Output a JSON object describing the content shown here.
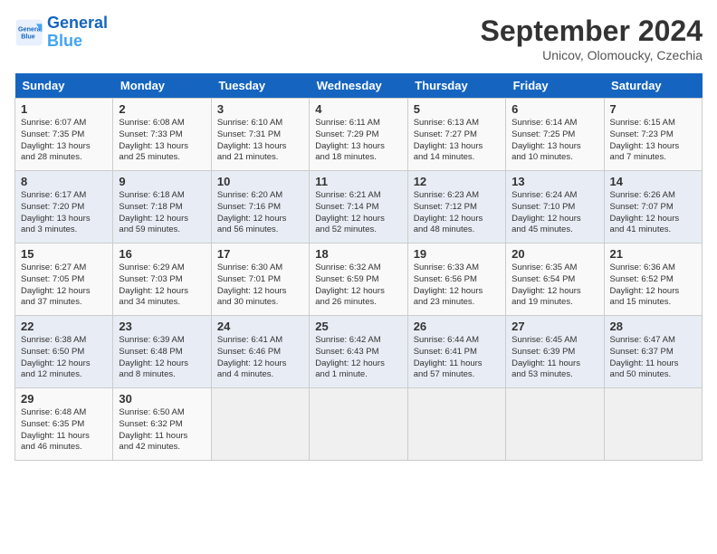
{
  "header": {
    "logo_line1": "General",
    "logo_line2": "Blue",
    "month": "September 2024",
    "location": "Unicov, Olomoucky, Czechia"
  },
  "weekdays": [
    "Sunday",
    "Monday",
    "Tuesday",
    "Wednesday",
    "Thursday",
    "Friday",
    "Saturday"
  ],
  "weeks": [
    [
      {
        "day": "1",
        "info": "Sunrise: 6:07 AM\nSunset: 7:35 PM\nDaylight: 13 hours\nand 28 minutes."
      },
      {
        "day": "2",
        "info": "Sunrise: 6:08 AM\nSunset: 7:33 PM\nDaylight: 13 hours\nand 25 minutes."
      },
      {
        "day": "3",
        "info": "Sunrise: 6:10 AM\nSunset: 7:31 PM\nDaylight: 13 hours\nand 21 minutes."
      },
      {
        "day": "4",
        "info": "Sunrise: 6:11 AM\nSunset: 7:29 PM\nDaylight: 13 hours\nand 18 minutes."
      },
      {
        "day": "5",
        "info": "Sunrise: 6:13 AM\nSunset: 7:27 PM\nDaylight: 13 hours\nand 14 minutes."
      },
      {
        "day": "6",
        "info": "Sunrise: 6:14 AM\nSunset: 7:25 PM\nDaylight: 13 hours\nand 10 minutes."
      },
      {
        "day": "7",
        "info": "Sunrise: 6:15 AM\nSunset: 7:23 PM\nDaylight: 13 hours\nand 7 minutes."
      }
    ],
    [
      {
        "day": "8",
        "info": "Sunrise: 6:17 AM\nSunset: 7:20 PM\nDaylight: 13 hours\nand 3 minutes."
      },
      {
        "day": "9",
        "info": "Sunrise: 6:18 AM\nSunset: 7:18 PM\nDaylight: 12 hours\nand 59 minutes."
      },
      {
        "day": "10",
        "info": "Sunrise: 6:20 AM\nSunset: 7:16 PM\nDaylight: 12 hours\nand 56 minutes."
      },
      {
        "day": "11",
        "info": "Sunrise: 6:21 AM\nSunset: 7:14 PM\nDaylight: 12 hours\nand 52 minutes."
      },
      {
        "day": "12",
        "info": "Sunrise: 6:23 AM\nSunset: 7:12 PM\nDaylight: 12 hours\nand 48 minutes."
      },
      {
        "day": "13",
        "info": "Sunrise: 6:24 AM\nSunset: 7:10 PM\nDaylight: 12 hours\nand 45 minutes."
      },
      {
        "day": "14",
        "info": "Sunrise: 6:26 AM\nSunset: 7:07 PM\nDaylight: 12 hours\nand 41 minutes."
      }
    ],
    [
      {
        "day": "15",
        "info": "Sunrise: 6:27 AM\nSunset: 7:05 PM\nDaylight: 12 hours\nand 37 minutes."
      },
      {
        "day": "16",
        "info": "Sunrise: 6:29 AM\nSunset: 7:03 PM\nDaylight: 12 hours\nand 34 minutes."
      },
      {
        "day": "17",
        "info": "Sunrise: 6:30 AM\nSunset: 7:01 PM\nDaylight: 12 hours\nand 30 minutes."
      },
      {
        "day": "18",
        "info": "Sunrise: 6:32 AM\nSunset: 6:59 PM\nDaylight: 12 hours\nand 26 minutes."
      },
      {
        "day": "19",
        "info": "Sunrise: 6:33 AM\nSunset: 6:56 PM\nDaylight: 12 hours\nand 23 minutes."
      },
      {
        "day": "20",
        "info": "Sunrise: 6:35 AM\nSunset: 6:54 PM\nDaylight: 12 hours\nand 19 minutes."
      },
      {
        "day": "21",
        "info": "Sunrise: 6:36 AM\nSunset: 6:52 PM\nDaylight: 12 hours\nand 15 minutes."
      }
    ],
    [
      {
        "day": "22",
        "info": "Sunrise: 6:38 AM\nSunset: 6:50 PM\nDaylight: 12 hours\nand 12 minutes."
      },
      {
        "day": "23",
        "info": "Sunrise: 6:39 AM\nSunset: 6:48 PM\nDaylight: 12 hours\nand 8 minutes."
      },
      {
        "day": "24",
        "info": "Sunrise: 6:41 AM\nSunset: 6:46 PM\nDaylight: 12 hours\nand 4 minutes."
      },
      {
        "day": "25",
        "info": "Sunrise: 6:42 AM\nSunset: 6:43 PM\nDaylight: 12 hours\nand 1 minute."
      },
      {
        "day": "26",
        "info": "Sunrise: 6:44 AM\nSunset: 6:41 PM\nDaylight: 11 hours\nand 57 minutes."
      },
      {
        "day": "27",
        "info": "Sunrise: 6:45 AM\nSunset: 6:39 PM\nDaylight: 11 hours\nand 53 minutes."
      },
      {
        "day": "28",
        "info": "Sunrise: 6:47 AM\nSunset: 6:37 PM\nDaylight: 11 hours\nand 50 minutes."
      }
    ],
    [
      {
        "day": "29",
        "info": "Sunrise: 6:48 AM\nSunset: 6:35 PM\nDaylight: 11 hours\nand 46 minutes."
      },
      {
        "day": "30",
        "info": "Sunrise: 6:50 AM\nSunset: 6:32 PM\nDaylight: 11 hours\nand 42 minutes."
      },
      {
        "day": "",
        "info": ""
      },
      {
        "day": "",
        "info": ""
      },
      {
        "day": "",
        "info": ""
      },
      {
        "day": "",
        "info": ""
      },
      {
        "day": "",
        "info": ""
      }
    ]
  ]
}
